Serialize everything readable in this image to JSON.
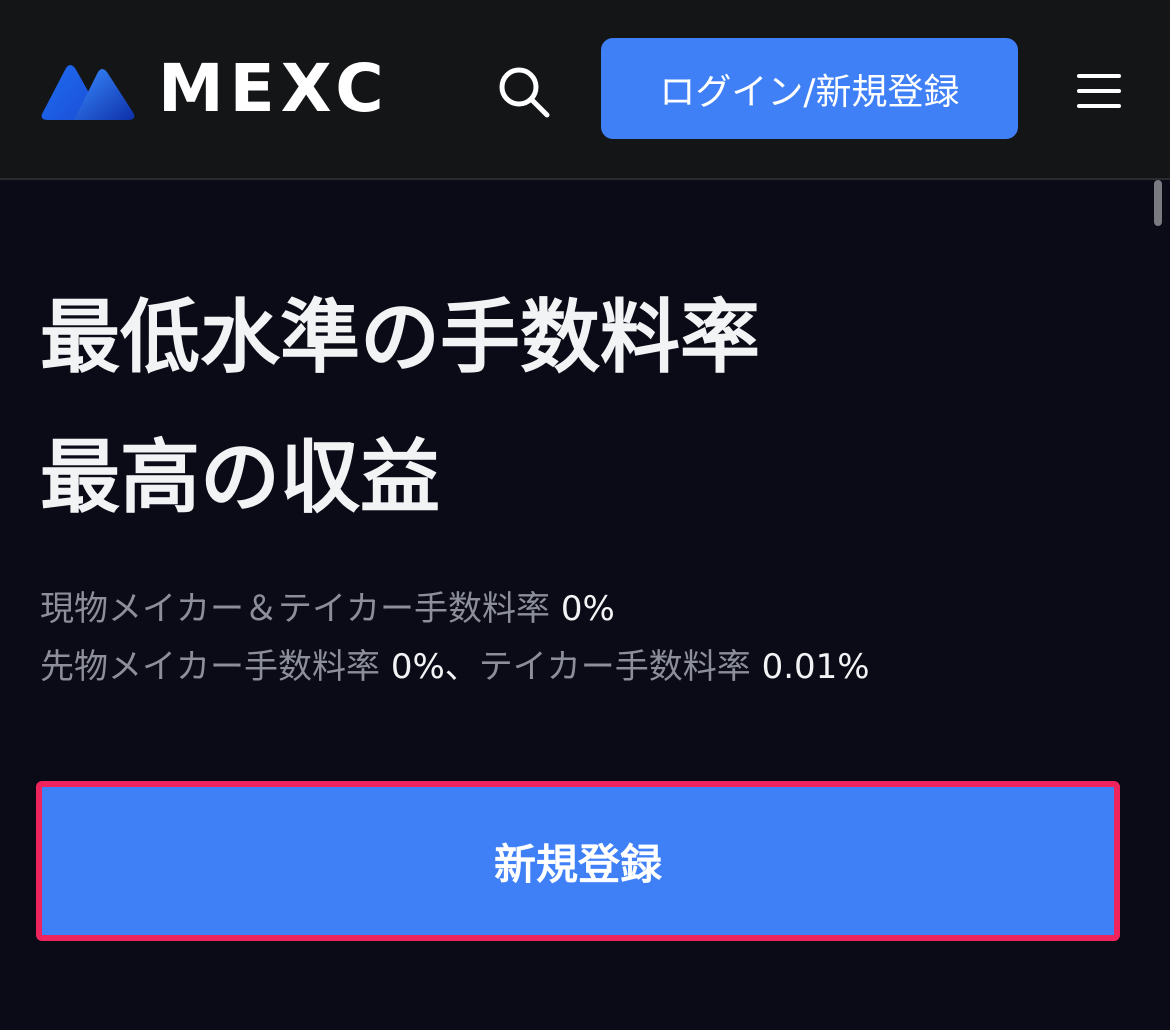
{
  "header": {
    "logo_text": "MEXC",
    "login_button_label": "ログイン/新規登録",
    "icons": [
      "logo-mark-icon",
      "search-icon",
      "hamburger-menu-icon"
    ]
  },
  "hero": {
    "headline_line1": "最低水準の手数料率",
    "headline_line2": "最高の収益",
    "fee_line1": {
      "label": "現物メイカー＆テイカー手数料率",
      "value": "0%"
    },
    "fee_line2": {
      "label_maker": "先物メイカー手数料率",
      "value_maker": "0%",
      "separator": "、",
      "label_taker": "テイカー手数料率",
      "value_taker": "0.01%"
    },
    "cta_label": "新規登録"
  },
  "colors": {
    "header_bg": "#141517",
    "page_bg": "#0a0b16",
    "accent_blue": "#4080f7",
    "highlight_border": "#f0245d",
    "muted_text": "#8c8e99",
    "headline_text": "#f2f3f5"
  }
}
